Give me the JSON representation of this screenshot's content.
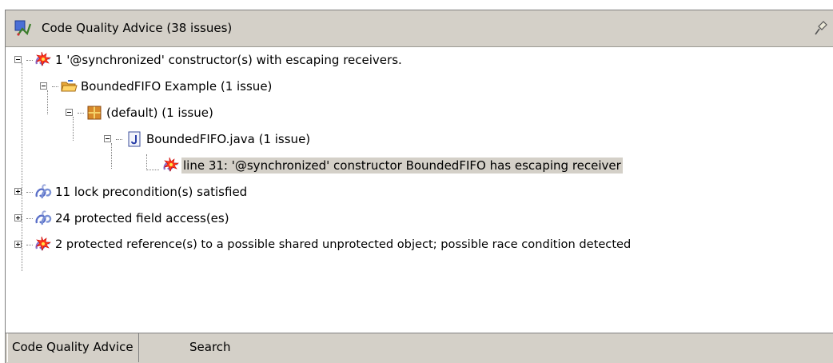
{
  "title": "Code Quality Advice (38 issues)",
  "tree": {
    "escaping": "1 '@synchronized' constructor(s) with escaping receivers.",
    "project": "BoundedFIFO Example (1 issue)",
    "package": "(default) (1 issue)",
    "file": "BoundedFIFO.java (1 issue)",
    "issue": "line 31: '@synchronized' constructor BoundedFIFO has escaping receiver",
    "lock": "11 lock precondition(s) satisfied",
    "protected": "24 protected field access(es)",
    "race": "2 protected reference(s) to a possible shared unprotected object; possible race condition detected"
  },
  "tabs": {
    "advice": "Code Quality Advice",
    "search": "Search"
  },
  "icons": {
    "title": "code-quality-view-icon",
    "pin": "pin-icon",
    "warning": "warning-link-icon",
    "ok": "ok-link-icon",
    "project": "project-folder-icon",
    "package": "package-icon",
    "java": "java-file-icon"
  }
}
